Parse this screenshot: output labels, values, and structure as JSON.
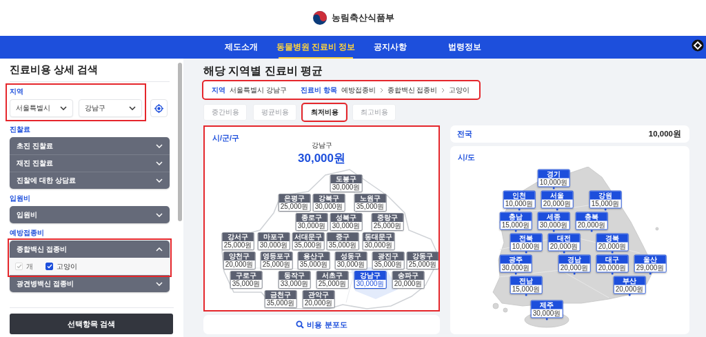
{
  "header": {
    "logo_text": "농림축산식품부"
  },
  "nav": {
    "items": [
      {
        "label": "제도소개",
        "selected": false
      },
      {
        "label": "동물병원 진료비 정보",
        "selected": true
      },
      {
        "label": "공지사항",
        "selected": false
      },
      {
        "label": "법령정보",
        "selected": false
      }
    ]
  },
  "sidebar": {
    "title": "진료비용 상세 검색",
    "region": {
      "label": "지역",
      "highlighted": true,
      "selects": [
        {
          "value": "서울특별시"
        },
        {
          "value": "강남구"
        }
      ]
    },
    "sections": [
      {
        "label": "진찰료",
        "items": [
          {
            "label": "초진 진찰료",
            "expanded": false
          },
          {
            "label": "재진 진찰료",
            "expanded": false
          },
          {
            "label": "진찰에 대한 상담료",
            "expanded": false
          }
        ]
      },
      {
        "label": "입원비",
        "items": [
          {
            "label": "입원비",
            "expanded": false
          }
        ]
      },
      {
        "label": "예방접종비",
        "items": [
          {
            "label": "종합백신 접종비",
            "expanded": true,
            "highlighted": true,
            "options": [
              {
                "label": "개",
                "checked": true,
                "disabled": true
              },
              {
                "label": "고양이",
                "checked": true,
                "disabled": false
              }
            ]
          },
          {
            "label": "광견병백신 접종비",
            "expanded": false
          }
        ]
      }
    ],
    "search_button": "선택항목 검색"
  },
  "main": {
    "title": "해당 지역별 진료비 평균",
    "breadcrumb": {
      "highlighted": true,
      "region_label": "지역",
      "region_value": "서울특별시 강남구",
      "item_label": "진료비 항목",
      "path": [
        "예방접종비",
        "종합백신 접종비",
        "고양이"
      ]
    },
    "cost_tabs": [
      {
        "label": "중간비용",
        "selected": false,
        "highlighted": false
      },
      {
        "label": "평균비용",
        "selected": false,
        "highlighted": false
      },
      {
        "label": "최저비용",
        "selected": true,
        "highlighted": true
      },
      {
        "label": "최고비용",
        "selected": false,
        "highlighted": false
      }
    ],
    "district_card": {
      "title": "시/군/구",
      "highlighted": true,
      "selected_name": "강남구",
      "selected_price": "30,000원",
      "districts": [
        {
          "name": "도봉구",
          "price": "30,000원",
          "selected": false
        },
        {
          "name": "은평구",
          "price": "25,000원",
          "selected": false
        },
        {
          "name": "강북구",
          "price": "30,000원",
          "selected": false
        },
        {
          "name": "노원구",
          "price": "35,000원",
          "selected": false
        },
        {
          "name": "종로구",
          "price": "30,000원",
          "selected": false
        },
        {
          "name": "성북구",
          "price": "30,000원",
          "selected": false
        },
        {
          "name": "중랑구",
          "price": "25,000원",
          "selected": false
        },
        {
          "name": "강서구",
          "price": "25,000원",
          "selected": false
        },
        {
          "name": "마포구",
          "price": "30,000원",
          "selected": false
        },
        {
          "name": "서대문구",
          "price": "35,000원",
          "selected": false
        },
        {
          "name": "중구",
          "price": "35,000원",
          "selected": false
        },
        {
          "name": "동대문구",
          "price": "30,000원",
          "selected": false
        },
        {
          "name": "양천구",
          "price": "20,000원",
          "selected": false
        },
        {
          "name": "영등포구",
          "price": "25,000원",
          "selected": false
        },
        {
          "name": "용산구",
          "price": "35,000원",
          "selected": false
        },
        {
          "name": "성동구",
          "price": "30,000원",
          "selected": false
        },
        {
          "name": "광진구",
          "price": "35,000원",
          "selected": false
        },
        {
          "name": "강동구",
          "price": "25,000원",
          "selected": false
        },
        {
          "name": "구로구",
          "price": "35,000원",
          "selected": false
        },
        {
          "name": "동작구",
          "price": "33,000원",
          "selected": false
        },
        {
          "name": "서초구",
          "price": "25,000원",
          "selected": false
        },
        {
          "name": "강남구",
          "price": "30,000원",
          "selected": true
        },
        {
          "name": "송파구",
          "price": "20,000원",
          "selected": false
        },
        {
          "name": "금천구",
          "price": "35,000원",
          "selected": false
        },
        {
          "name": "관악구",
          "price": "20,000원",
          "selected": false
        }
      ]
    },
    "distribution_button": "비용 분포도",
    "national": {
      "label": "전국",
      "price": "10,000원"
    },
    "province_card": {
      "title": "시/도",
      "provinces": [
        {
          "name": "경기",
          "price": "10,000원"
        },
        {
          "name": "인천",
          "price": "10,000원"
        },
        {
          "name": "서울",
          "price": "20,000원"
        },
        {
          "name": "강원",
          "price": "15,000원"
        },
        {
          "name": "충남",
          "price": "15,000원"
        },
        {
          "name": "세종",
          "price": "30,000원"
        },
        {
          "name": "충북",
          "price": "20,000원"
        },
        {
          "name": "전북",
          "price": "10,000원"
        },
        {
          "name": "대전",
          "price": "20,000원"
        },
        {
          "name": "경북",
          "price": "20,000원"
        },
        {
          "name": "광주",
          "price": "30,000원"
        },
        {
          "name": "경남",
          "price": "20,000원"
        },
        {
          "name": "대구",
          "price": "20,000원"
        },
        {
          "name": "울산",
          "price": "29,000원"
        },
        {
          "name": "전남",
          "price": "15,000원"
        },
        {
          "name": "부산",
          "price": "20,000원"
        },
        {
          "name": "제주",
          "price": "30,000원"
        }
      ]
    }
  }
}
